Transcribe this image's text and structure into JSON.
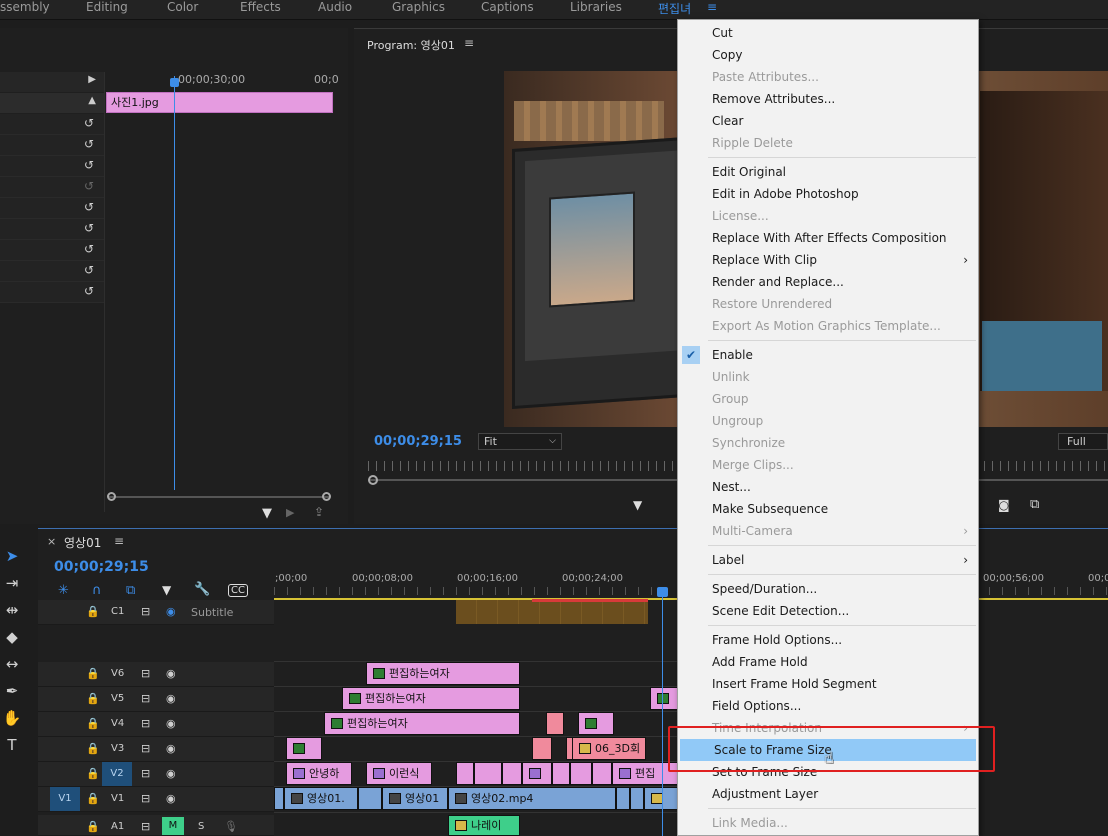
{
  "workspaces": [
    "ssembly",
    "Editing",
    "Color",
    "Effects",
    "Audio",
    "Graphics",
    "Captions",
    "Libraries",
    "편집녀"
  ],
  "effect_controls": {
    "timecode_ruler": "00;00;30;00",
    "ruler_end": "00;0",
    "clip_name": "사진1.jpg"
  },
  "program_monitor": {
    "title": "Program: 영상01",
    "timecode": "00;00;29;15",
    "fit_label": "Fit",
    "quality_label": "Full"
  },
  "timeline": {
    "tab_label": "영상01",
    "timecode": "00;00;29;15",
    "ruler": [
      ";00;00",
      "00;00;08;00",
      "00;00;16;00",
      "00;00;24;00",
      "00;00;56;00",
      "00;0"
    ],
    "subtitle_track": {
      "name": "C1",
      "label": "Subtitle"
    },
    "tracks": [
      {
        "name": "V6"
      },
      {
        "name": "V5"
      },
      {
        "name": "V4"
      },
      {
        "name": "V3"
      },
      {
        "name": "V2"
      },
      {
        "name": "V1",
        "target": "V1"
      },
      {
        "name": "A1",
        "m": "M",
        "s": "S"
      }
    ],
    "clips": {
      "v6": "편집하는여자",
      "v5": "편집하는여자",
      "v4": "편집하는여자",
      "v3": "06_3D회",
      "v2a": "안녕하",
      "v2b": "이런식",
      "v2c": "편집",
      "v1a": "영상01.",
      "v1b": "영상01",
      "v1c": "영상02.mp4",
      "a1": "나레이"
    }
  },
  "context_menu": {
    "items": [
      {
        "label": "Cut",
        "enabled": true
      },
      {
        "label": "Copy",
        "enabled": true
      },
      {
        "label": "Paste Attributes...",
        "enabled": false
      },
      {
        "label": "Remove Attributes...",
        "enabled": true
      },
      {
        "label": "Clear",
        "enabled": true
      },
      {
        "label": "Ripple Delete",
        "enabled": false
      },
      {
        "label": "Edit Original",
        "enabled": true
      },
      {
        "label": "Edit in Adobe Photoshop",
        "enabled": true
      },
      {
        "label": "License...",
        "enabled": false
      },
      {
        "label": "Replace With After Effects Composition",
        "enabled": true
      },
      {
        "label": "Replace With Clip",
        "enabled": true,
        "submenu": true
      },
      {
        "label": "Render and Replace...",
        "enabled": true
      },
      {
        "label": "Restore Unrendered",
        "enabled": false
      },
      {
        "label": "Export As Motion Graphics Template...",
        "enabled": false
      },
      {
        "label": "Enable",
        "enabled": true,
        "checked": true
      },
      {
        "label": "Unlink",
        "enabled": false
      },
      {
        "label": "Group",
        "enabled": false
      },
      {
        "label": "Ungroup",
        "enabled": false
      },
      {
        "label": "Synchronize",
        "enabled": false
      },
      {
        "label": "Merge Clips...",
        "enabled": false
      },
      {
        "label": "Nest...",
        "enabled": true
      },
      {
        "label": "Make Subsequence",
        "enabled": true
      },
      {
        "label": "Multi-Camera",
        "enabled": false,
        "submenu": true
      },
      {
        "label": "Label",
        "enabled": true,
        "submenu": true
      },
      {
        "label": "Speed/Duration...",
        "enabled": true
      },
      {
        "label": "Scene Edit Detection...",
        "enabled": true
      },
      {
        "label": "Frame Hold Options...",
        "enabled": true
      },
      {
        "label": "Add Frame Hold",
        "enabled": true
      },
      {
        "label": "Insert Frame Hold Segment",
        "enabled": true
      },
      {
        "label": "Field Options...",
        "enabled": true
      },
      {
        "label": "Time Interpolation",
        "enabled": false,
        "submenu": true
      },
      {
        "label": "Scale to Frame Size",
        "enabled": true,
        "highlighted": true
      },
      {
        "label": "Set to Frame Size",
        "enabled": true
      },
      {
        "label": "Adjustment Layer",
        "enabled": true
      },
      {
        "label": "Link Media...",
        "enabled": false
      }
    ]
  },
  "colors": {
    "accent": "#3d8de8",
    "menu_highlight": "#91c9f7",
    "annotation": "#e02020"
  }
}
